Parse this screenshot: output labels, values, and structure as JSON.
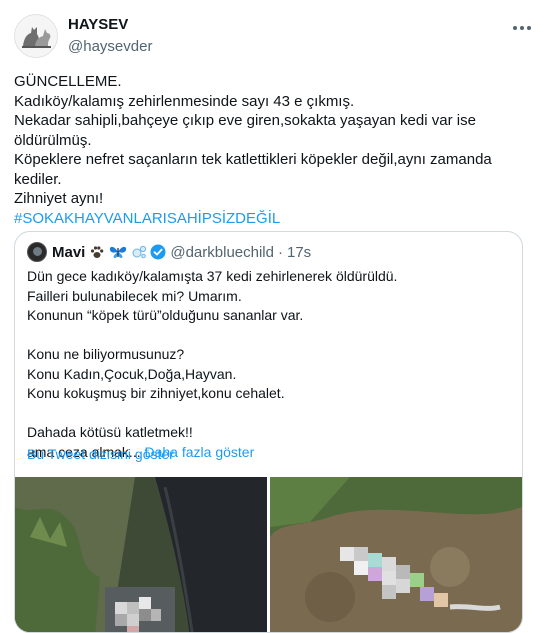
{
  "author": {
    "name": "HAYSEV",
    "handle": "@haysevder",
    "avatar_icon": "dog-cat-logo-icon"
  },
  "menu_icon": "more-horizontal-icon",
  "tweet_lines": [
    "GÜNCELLEME.",
    "Kadıköy/kalamış zehirlenmesinde sayı 43 e çıkmış.",
    "Nekadar sahipli,bahçeye çıkıp eve giren,sokakta yaşayan kedi var ise",
    "öldürülmüş.",
    "Köpeklere nefret saçanların tek katlettikleri köpekler değil,aynı zamanda",
    "kediler.",
    "Zihniyet aynı!"
  ],
  "hashtag": "#SOKAKHAYVANLARISAHİPSİZDEĞİL",
  "quoted": {
    "name": "Mavi",
    "emojis": [
      "paw-prints-emoji",
      "butterfly-emoji",
      "bubbles-emoji"
    ],
    "verified_icon": "verified-badge-icon",
    "handle": "@darkbluechild",
    "separator": "·",
    "time": "17s",
    "lines": [
      "Dün gece kadıköy/kalamışta 37 kedi zehirlenerek öldürüldü.",
      "Failleri bulunabilecek mi? Umarım.",
      "Konunun “köpek türü”olduğunu sananlar var.",
      "",
      "Konu ne biliyormusunuz?",
      "Konu Kadın,Çocuk,Doğa,Hayvan.",
      "Konu kokuşmuş bir zihniyet,konu cehalet.",
      "",
      "Dahada kötüsü katletmek!!"
    ],
    "last_line": "ama ceza almak...",
    "show_more": "Daha fazla göster",
    "thread_link": "Bu Tweet dizisini göster"
  },
  "colors": {
    "text": "#0f1419",
    "secondary": "#536471",
    "accent": "#1d9bf0",
    "border": "#cfd9de"
  }
}
